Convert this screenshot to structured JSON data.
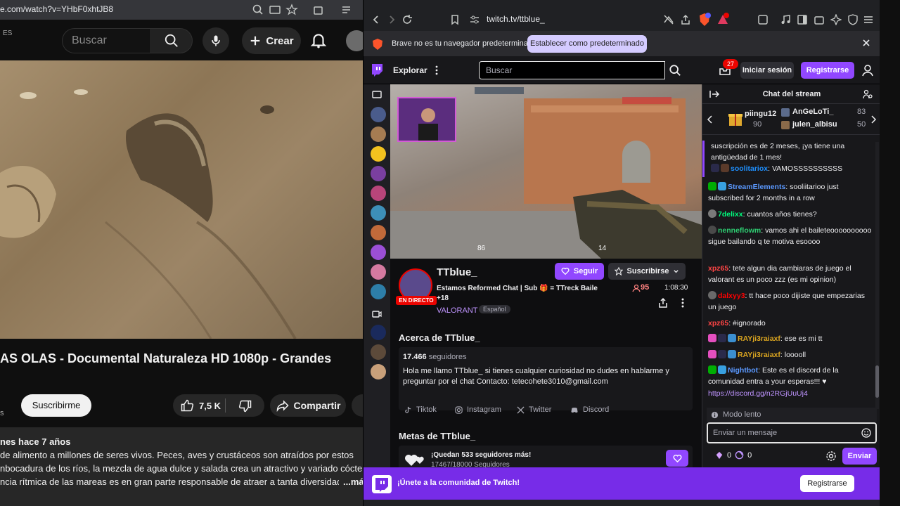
{
  "youtube": {
    "url": "e.com/watch?v=YHbF0xhtJB8",
    "region_code": "ES",
    "search_placeholder": "Buscar",
    "create_label": "Crear",
    "video_title": "AS OLAS - Documental Naturaleza HD 1080p - Grandes",
    "channel_sub_fragment": "s",
    "subscribe_label": "Suscribirme",
    "likes": "7,5 K",
    "share_label": "Compartir",
    "description": {
      "meta": "nes  hace 7 años",
      "lines": [
        "de alimento a millones de seres vivos. Peces, aves y crustáceos son atraídos por estos",
        "nbocadura de los ríos, la mezcla de agua dulce y salada crea un atractivo y variado cóctel,",
        "ncia rítmica de las mareas es en gran parte responsable de atraer a tanta diversidad"
      ],
      "more": "...má"
    }
  },
  "brave": {
    "url": "twitch.tv/ttblue_",
    "info_text": "Brave no es tu navegador predeterminado",
    "info_button": "Establecer como predeterminado"
  },
  "twitch": {
    "explore": "Explorar",
    "search_placeholder": "Buscar",
    "inbox_count": "27",
    "login": "Iniciar sesión",
    "register": "Registrarse",
    "channel": {
      "name": "TTblue_",
      "live_badge": "EN DIRECTO",
      "stream_title": "Estamos Reformed Chat | Sub 🎁 = TTreck Baile +18",
      "game": "VALORANT",
      "language": "Español",
      "follow": "Seguir",
      "subscribe": "Suscribirse",
      "viewers": "95",
      "uptime": "1:08:30"
    },
    "about": {
      "heading": "Acerca de TTblue_",
      "followers_count": "17.466",
      "followers_label": "seguidores",
      "bio": "Hola me llamo TTblue_ si tienes cualquier curiosidad no dudes en hablarme y preguntar por el chat Contacto: tetecohete3010@gmail.com",
      "socials": [
        "Tiktok",
        "Instagram",
        "Twitter",
        "Discord"
      ]
    },
    "goals": {
      "heading": "Metas de TTblue_",
      "title": "¡Quedan 533 seguidores más!",
      "progress": "17467/18000 Seguidores"
    },
    "chat": {
      "title": "Chat del stream",
      "gifters": [
        {
          "name": "piingu12",
          "count": "90"
        },
        {
          "name": "AnGeLoTi_",
          "count": "83"
        },
        {
          "name": "julen_albisu",
          "count": "50"
        }
      ],
      "messages": [
        {
          "user": "",
          "color": "#efeff1",
          "text": "suscripción es de 2 meses, ¡ya tiene una antigüedad de 1 mes!"
        },
        {
          "user": "soolitariox",
          "color": "#1e90ff",
          "text": ": VAMOSSSSSSSSSS"
        },
        {
          "user": "StreamElements",
          "color": "#5b99ff",
          "text": ": sooliitarioo just subscribed for 2 months in a row"
        },
        {
          "user": "7delixx",
          "color": "#00ff7f",
          "text": ": cuantos años tienes?"
        },
        {
          "user": "nenneflowm",
          "color": "#2ecc71",
          "text": ": vamos ahi el baileteoooooooooo sigue bailando q te motiva esoooo"
        },
        {
          "user": "xpz65",
          "color": "#ff4545",
          "text": ": tete algun dia cambiaras de juego el valorant es un poco zzz (es mi opinion)"
        },
        {
          "user": "dalxyy3",
          "color": "#ff0000",
          "text": ": tt hace poco dijiste que empezarias un juego"
        },
        {
          "user": "xpz65",
          "color": "#ff4545",
          "text": ": #ignorado"
        },
        {
          "user": "RAYji3raiaxf",
          "color": "#daa520",
          "text": ": ese es mi tt"
        },
        {
          "user": "RAYji3raiaxf",
          "color": "#daa520",
          "text": ": looooll"
        },
        {
          "user": "Nightbot",
          "color": "#5b99ff",
          "text": ": Este es el discord de la comunidad entra a your esperas!!! ♥"
        },
        {
          "user": "",
          "color": "#bf94ff",
          "text": "https://discord.gg/n2RGjUuUj4"
        }
      ],
      "slow_mode": "Modo lento",
      "input_placeholder": "Enviar un mensaje",
      "points_a": "0",
      "points_b": "0",
      "send": "Enviar"
    },
    "banner": {
      "text": "¡Únete a la comunidad de Twitch!",
      "button": "Registrarse"
    },
    "game_hud": {
      "hp": "86",
      "ammo": "14"
    }
  },
  "colors": {
    "twitch_purple": "#9147ff",
    "live_red": "#eb0400",
    "brave_accent": "#d4cbff"
  }
}
